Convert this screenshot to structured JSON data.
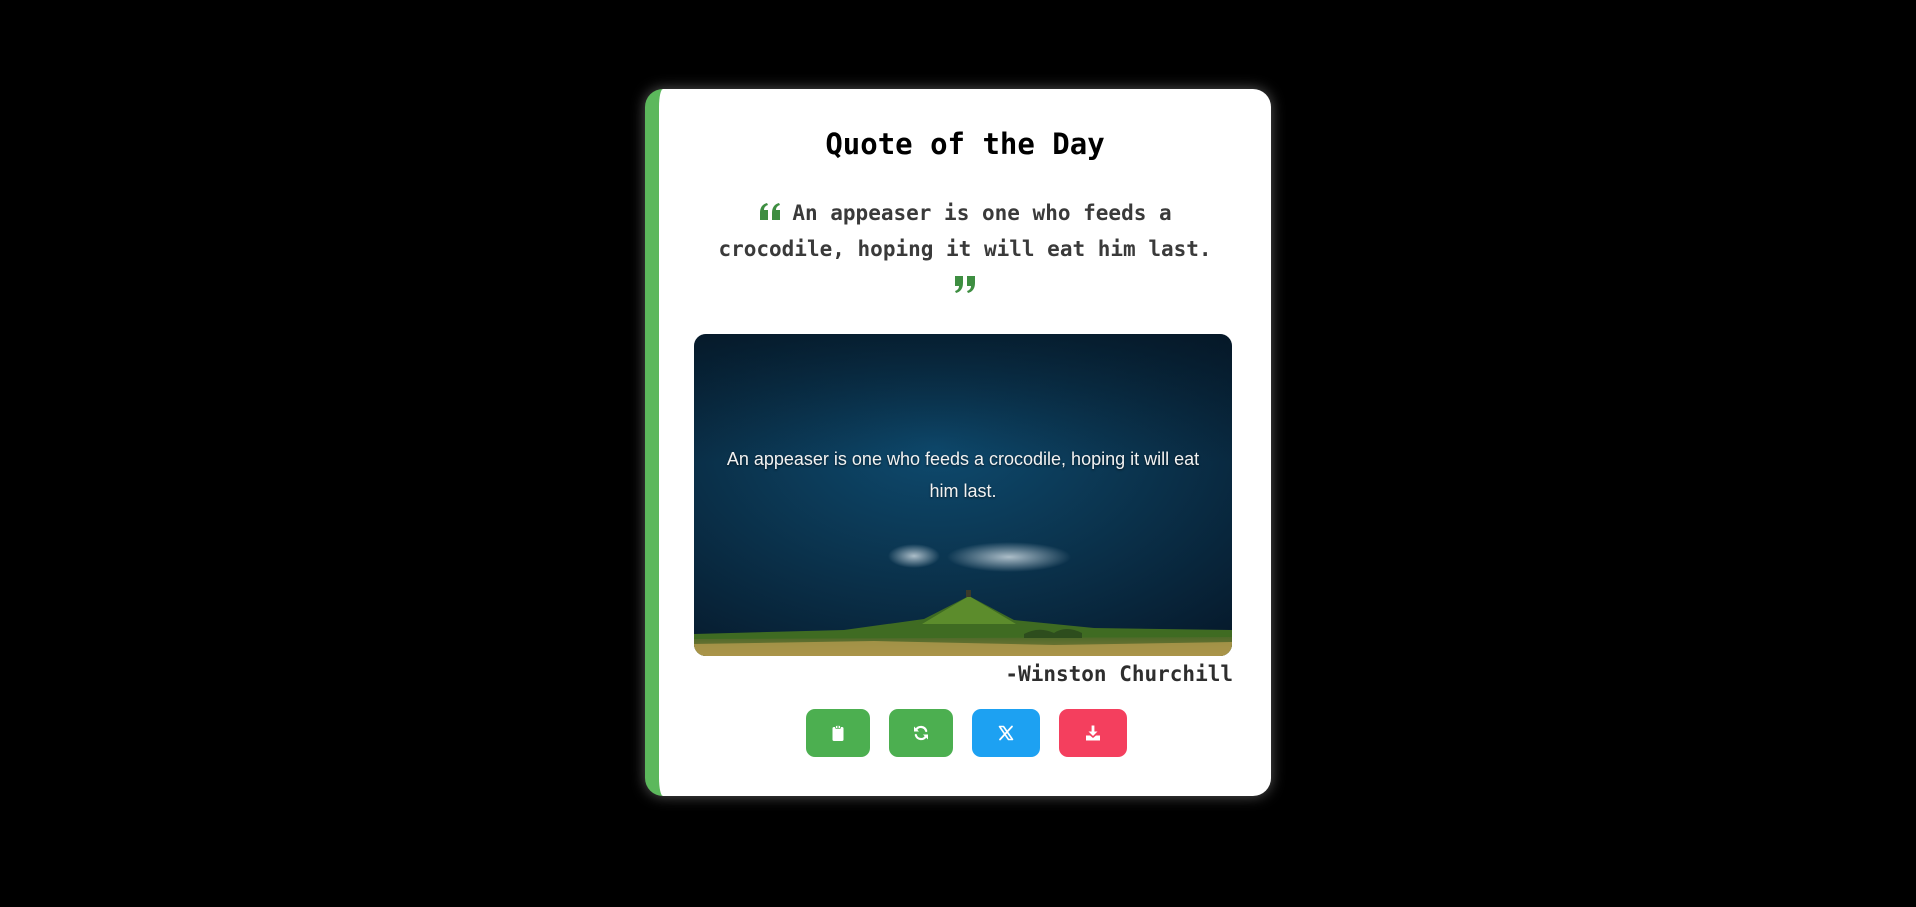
{
  "card": {
    "title": "Quote of the Day",
    "quote_text": "An appeaser is one who feeds a crocodile, hoping it will eat him last.",
    "image_caption": "An appeaser is one who feeds a crocodile, hoping it will eat him last.",
    "author": "-Winston Churchill",
    "open_quote_icon": "quote-left-icon",
    "close_quote_icon": "quote-right-icon"
  },
  "actions": [
    {
      "name": "copy",
      "icon": "clipboard-icon",
      "color": "#4caf50"
    },
    {
      "name": "new-quote",
      "icon": "refresh-icon",
      "color": "#4caf50"
    },
    {
      "name": "share-x",
      "icon": "x-logo-icon",
      "color": "#1da1f2"
    },
    {
      "name": "download",
      "icon": "download-icon",
      "color": "#f43f5e"
    }
  ],
  "colors": {
    "background": "#000000",
    "card": "#ffffff",
    "accent_border": "#5cb85c",
    "quote_mark": "#3e8e41"
  }
}
